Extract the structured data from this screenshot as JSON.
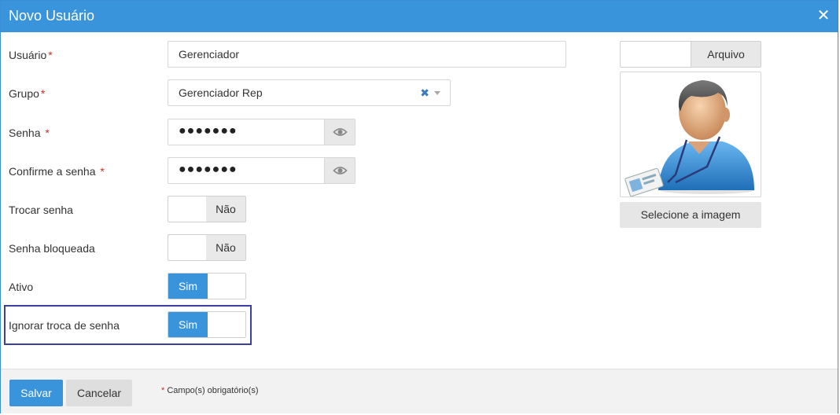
{
  "dialog": {
    "title": "Novo Usuário",
    "close_icon": "close-icon"
  },
  "form": {
    "usuario": {
      "label": "Usuário",
      "required": "*",
      "value": "Gerenciador"
    },
    "grupo": {
      "label": "Grupo",
      "required": "*",
      "value": "Gerenciador Rep",
      "clear": "✖"
    },
    "senha": {
      "label": "Senha",
      "required": "*",
      "value": "●●●●●●●",
      "eye_icon": "eye-icon"
    },
    "confirme": {
      "label": "Confirme a senha",
      "required": "*",
      "value": "●●●●●●●",
      "eye_icon": "eye-icon"
    },
    "trocar_senha": {
      "label": "Trocar senha",
      "state": "Não",
      "on": false
    },
    "senha_bloqueada": {
      "label": "Senha bloqueada",
      "state": "Não",
      "on": false
    },
    "ativo": {
      "label": "Ativo",
      "state": "Sim",
      "on": true
    },
    "ignorar_troca": {
      "label": "Ignorar troca de senha",
      "state": "Sim",
      "on": true
    }
  },
  "image_panel": {
    "file_button": "Arquivo",
    "avatar_icon": "user-avatar-icon",
    "select_button": "Selecione a imagem"
  },
  "footer": {
    "save": "Salvar",
    "cancel": "Cancelar",
    "required_mark": "*",
    "required_note": "Campo(s) obrigatório(s)"
  },
  "colors": {
    "accent": "#3a94dc",
    "required": "#c9302c",
    "highlight": "#3b3fa0"
  }
}
